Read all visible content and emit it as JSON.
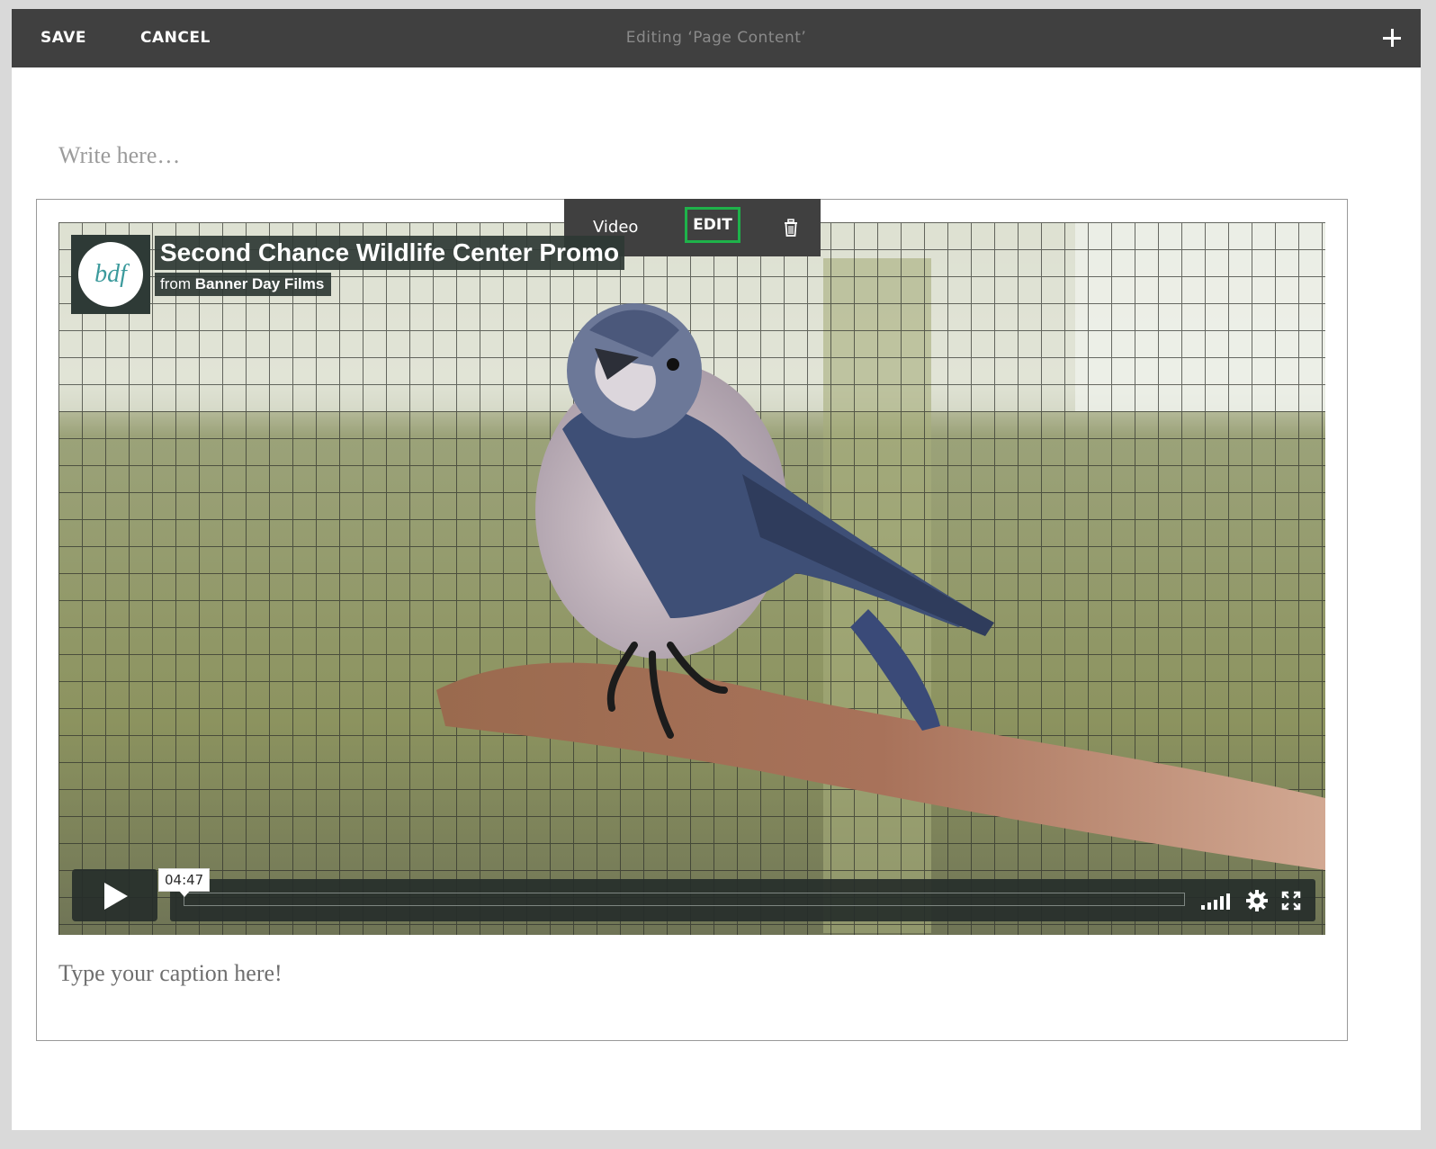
{
  "topbar": {
    "save_label": "SAVE",
    "cancel_label": "CANCEL",
    "title": "Editing ‘Page Content’",
    "add_icon": "plus-icon"
  },
  "editor": {
    "placeholder": "Write here…",
    "caption_placeholder": "Type your caption here!"
  },
  "block_toolbar": {
    "type_label": "Video",
    "edit_label": "EDIT",
    "delete_icon": "trash-icon",
    "edit_highlight_color": "#1eb24a"
  },
  "video": {
    "title": "Second Chance Wildlife Center Promo",
    "from_prefix": "from",
    "channel": "Banner Day Films",
    "logo_text": "bdf",
    "duration": "04:47",
    "controls_icons": [
      "play-icon",
      "volume-icon",
      "gear-icon",
      "fullscreen-icon"
    ]
  }
}
